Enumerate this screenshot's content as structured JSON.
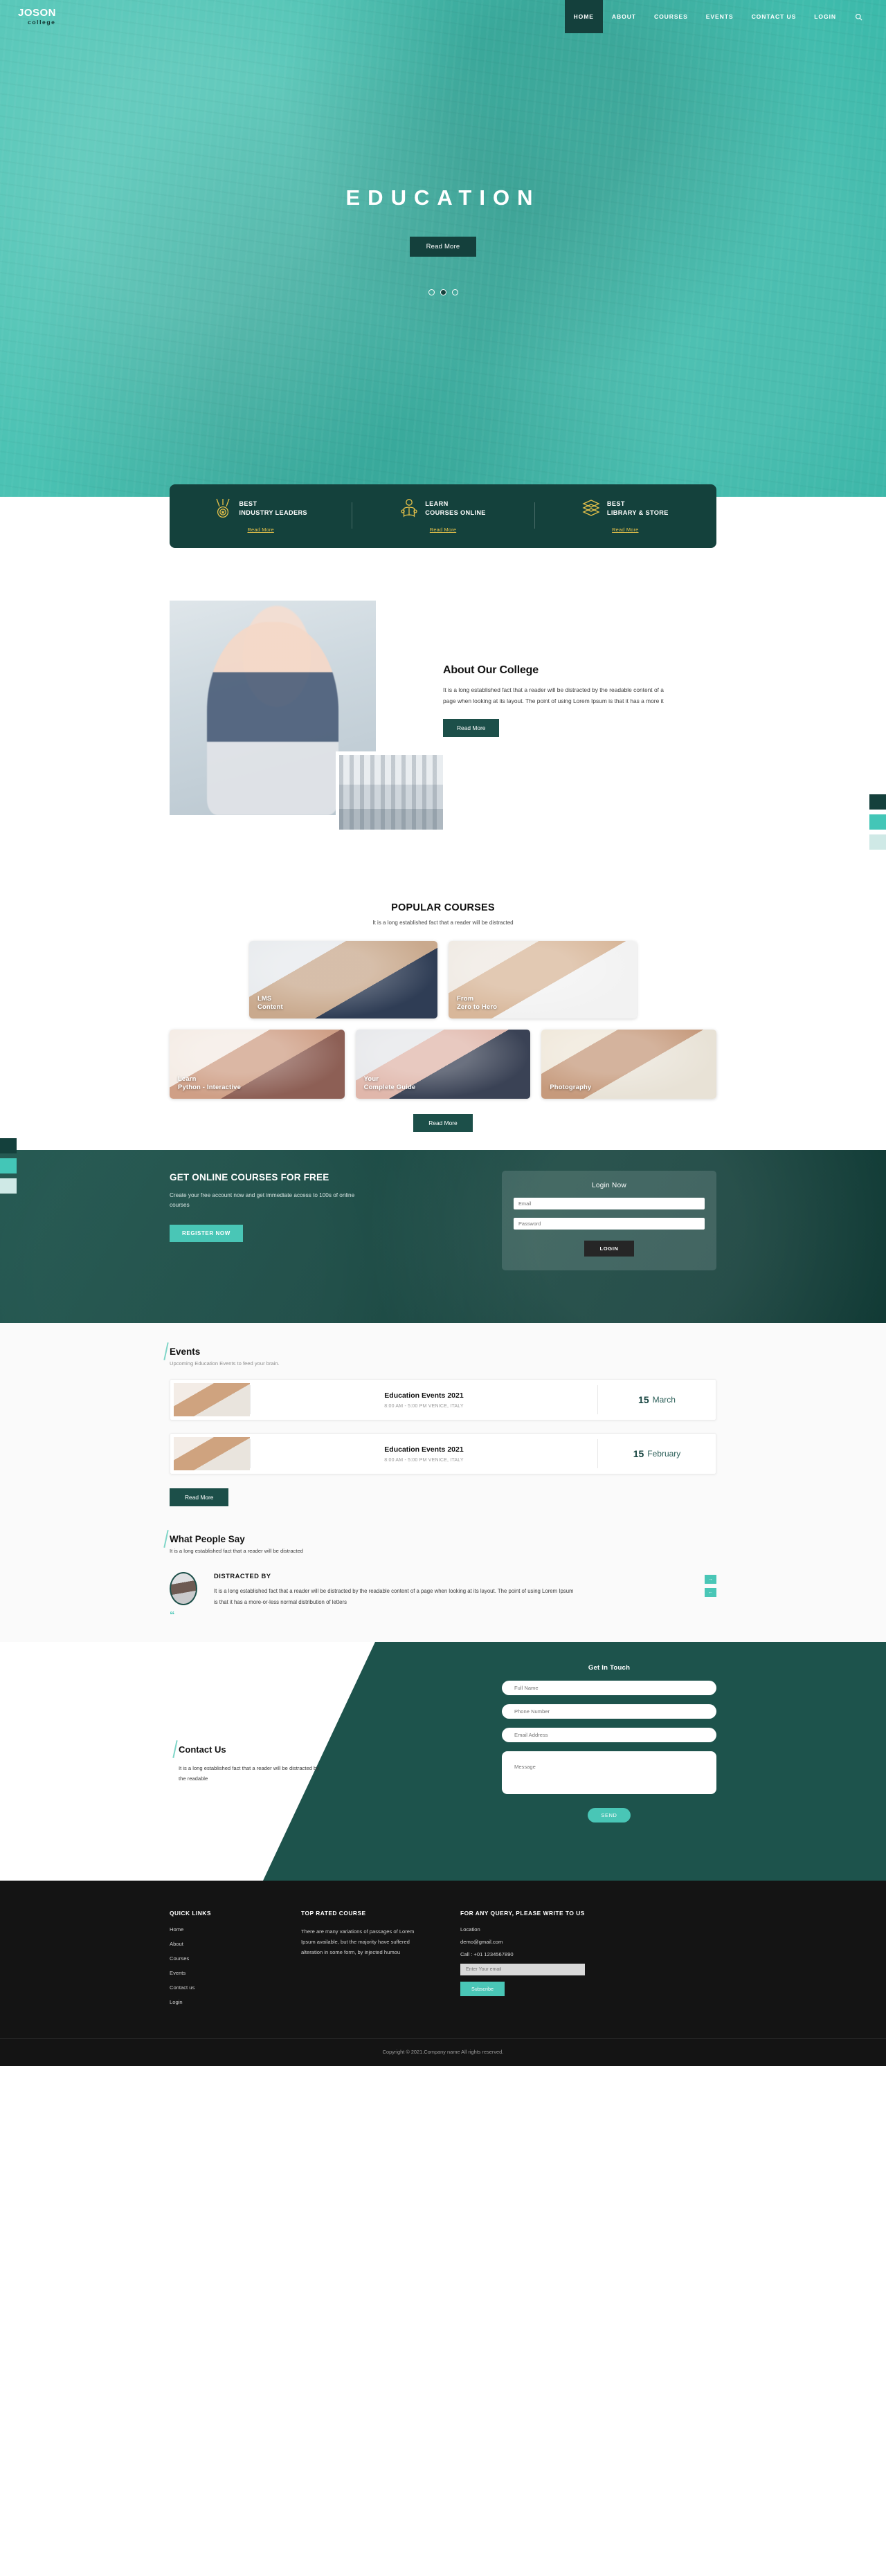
{
  "brand": {
    "name": "JOSON",
    "tagline": "college"
  },
  "nav": {
    "items": [
      {
        "label": "HOME",
        "active": true
      },
      {
        "label": "ABOUT",
        "active": false
      },
      {
        "label": "COURSES",
        "active": false
      },
      {
        "label": "EVENTS",
        "active": false
      },
      {
        "label": "CONTACT US",
        "active": false
      },
      {
        "label": "LOGIN",
        "active": false
      }
    ],
    "search_icon": "search-icon"
  },
  "hero": {
    "title": "EDUCATION",
    "button": "Read More",
    "dots": 3,
    "active_dot": 1
  },
  "features": [
    {
      "icon": "medal-icon",
      "line1": "BEST",
      "line2": "INDUSTRY LEADERS",
      "link": "Read More"
    },
    {
      "icon": "reader-icon",
      "line1": "LEARN",
      "line2": "COURSES ONLINE",
      "link": "Read More"
    },
    {
      "icon": "books-icon",
      "line1": "BEST",
      "line2": "LIBRARY & STORE",
      "link": "Read More"
    }
  ],
  "about": {
    "heading": "About Our College",
    "paragraph": "It is a long established fact that a reader will be distracted by the readable content of a page when looking at its layout. The point of using Lorem Ipsum is that it has a more it",
    "button": "Read More"
  },
  "courses": {
    "heading": "POPULAR COURSES",
    "subheading": "It is a long established fact that a reader will be distracted",
    "row1": [
      {
        "line1": "LMS",
        "line2": "Content"
      },
      {
        "line1": "From",
        "line2": "Zero to Hero"
      }
    ],
    "row2": [
      {
        "line1": "Learn",
        "line2": "Python - Interactive"
      },
      {
        "line1": "Your",
        "line2": "Complete Guide"
      },
      {
        "line1": "",
        "line2": "Photography"
      }
    ],
    "button": "Read More"
  },
  "banner": {
    "heading": "GET ONLINE COURSES FOR FREE",
    "paragraph": "Create your free account now and get immediate access to 100s of online courses",
    "button": "REGISTER NOW",
    "login": {
      "heading": "Login Now",
      "email_placeholder": "Email",
      "password_placeholder": "Password",
      "button": "LOGIN"
    }
  },
  "events": {
    "heading": "Events",
    "subheading": "Upcoming Education Events to feed your brain.",
    "items": [
      {
        "title": "Education Events 2021",
        "meta": "8:00 AM - 5:00 PM VENICE, ITALY",
        "day": "15",
        "month": "March"
      },
      {
        "title": "Education Events 2021",
        "meta": "8:00 AM - 5:00 PM VENICE, ITALY",
        "day": "15",
        "month": "February"
      }
    ],
    "button": "Read More"
  },
  "testimonials": {
    "heading": "What People Say",
    "subheading": "It is a long established fact that a reader will be distracted",
    "name": "DISTRACTED BY",
    "quote": "It is a long established fact that a reader will be distracted by the readable content of a page when looking at its layout. The point of using Lorem Ipsum is that it has a more-or-less normal distribution of letters",
    "quote_mark": "“",
    "next_arrow": "→",
    "prev_arrow": "←"
  },
  "contact": {
    "heading": "Contact Us",
    "paragraph": "It is a long established fact that a reader will be distracted by the readable",
    "form_heading": "Get In Touch",
    "fields": {
      "name": "Full Name",
      "phone": "Phone Number",
      "email": "Email Address",
      "message": "Message"
    },
    "send_button": "SEND"
  },
  "footer": {
    "quick_links_heading": "QUICK LINKS",
    "quick_links": [
      "Home",
      "About",
      "Courses",
      "Events",
      "Contact us",
      "Login"
    ],
    "top_rated_heading": "TOP RATED COURSE",
    "top_rated_text": "There are many variations of passages of Lorem Ipsum available, but the majority have suffered alteration in some form, by injected humou",
    "query_heading": "FOR ANY QUERY, PLEASE WRITE TO US",
    "location": "Location",
    "email": "demo@gmail.com",
    "phone": "Call : +01 1234567890",
    "subscribe_placeholder": "Enter Your email",
    "subscribe_button": "Subscribe",
    "copyright": "Copyright © 2021.Company name All rights reserved."
  },
  "colors": {
    "teal_dark": "#14403c",
    "teal_mid": "#43c6b7",
    "teal_light": "#cfe9e6",
    "gold": "#e7c24a",
    "accent": "#49c6b6"
  }
}
